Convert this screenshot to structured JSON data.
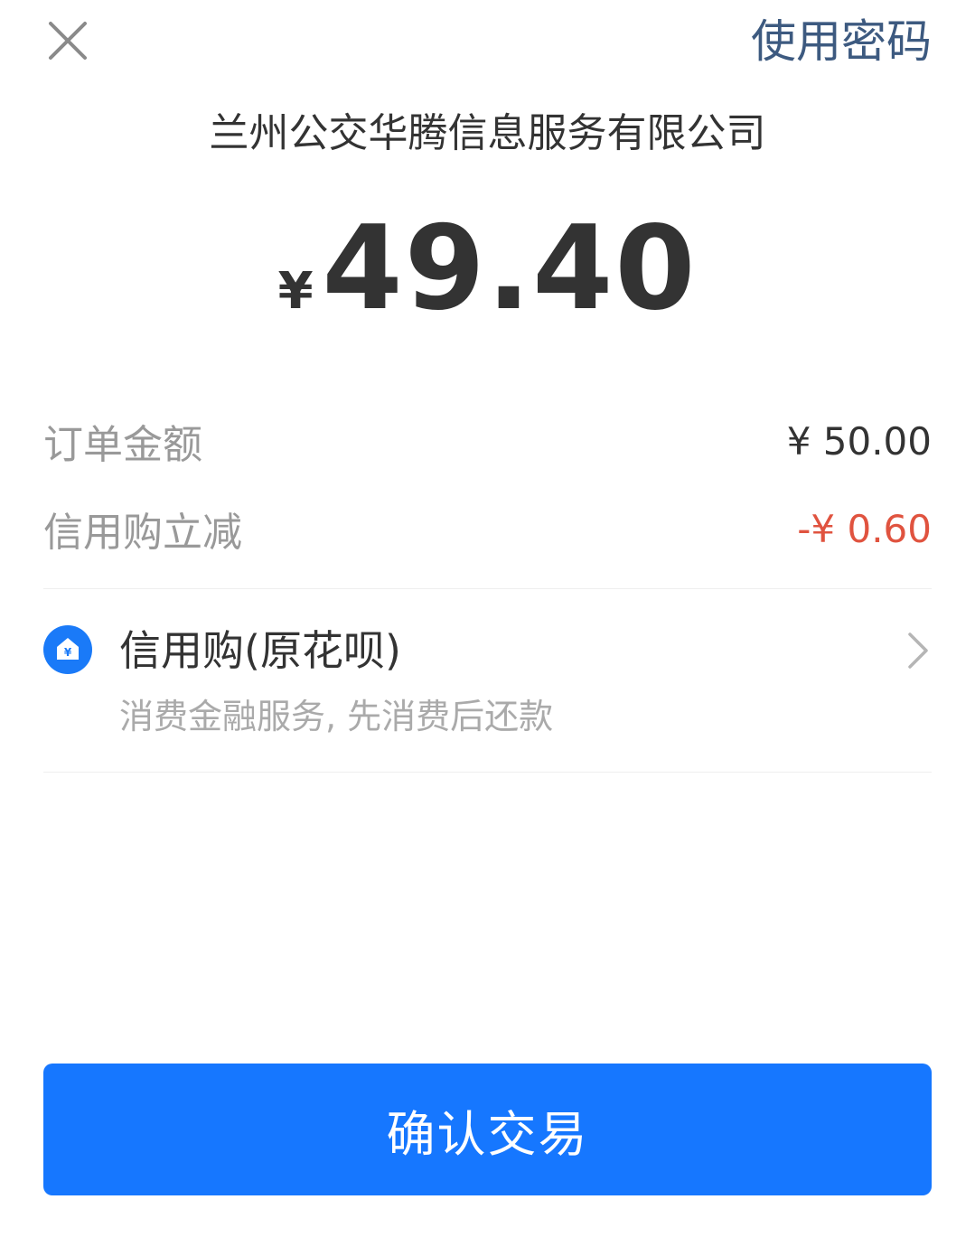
{
  "header": {
    "close_icon": "close-icon",
    "use_password_label": "使用密码"
  },
  "merchant": {
    "name": "兰州公交华腾信息服务有限公司"
  },
  "amount": {
    "currency": "¥",
    "value": "49.40"
  },
  "details": {
    "order_label": "订单金额",
    "order_value": "¥ 50.00",
    "discount_label": "信用购立减",
    "discount_value": "-¥ 0.60"
  },
  "payment_method": {
    "icon": "credit-purchase-icon",
    "title": "信用购(原花呗)",
    "subtitle": "消费金融服务, 先消费后还款",
    "chevron_icon": "chevron-right-icon"
  },
  "confirm": {
    "label": "确认交易"
  },
  "colors": {
    "primary": "#1677ff",
    "link": "#3d5a80",
    "discount": "#e0533f",
    "muted": "#999999"
  }
}
